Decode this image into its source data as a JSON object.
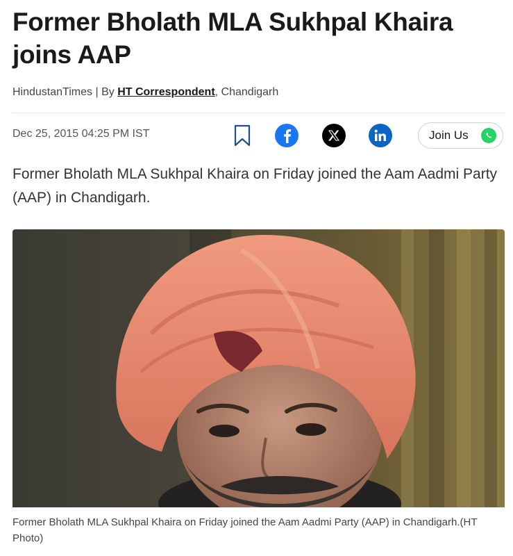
{
  "article": {
    "headline": "Former Bholath MLA Sukhpal Khaira joins AAP",
    "source": "HindustanTimes",
    "by_prefix": "| By",
    "author": "HT Correspondent",
    "location": ", Chandigarh",
    "date": "Dec 25, 2015 04:25 PM IST",
    "summary": "Former Bholath MLA Sukhpal Khaira on Friday joined the Aam Aadmi Party (AAP) in Chandigarh.",
    "caption": "Former Bholath MLA Sukhpal Khaira on Friday joined the Aam Aadmi Party (AAP) in Chandigarh.(HT Photo)"
  },
  "share": {
    "join_label": "Join Us",
    "icons": [
      "bookmark-icon",
      "facebook-icon",
      "x-icon",
      "linkedin-icon",
      "whatsapp-icon"
    ]
  },
  "colors": {
    "facebook": "#1877f2",
    "x": "#000000",
    "linkedin": "#0a66c2",
    "whatsapp": "#25d366",
    "turban": "#e8836a"
  }
}
